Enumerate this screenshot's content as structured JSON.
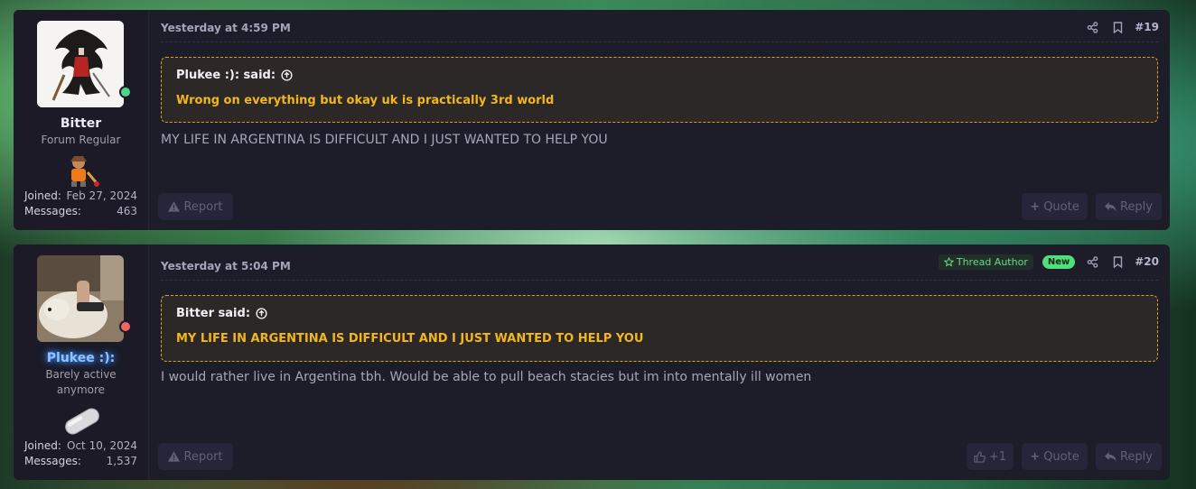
{
  "posts": [
    {
      "user": {
        "name": "Bitter",
        "title": "Forum Regular",
        "joined_label": "Joined:",
        "joined_value": "Feb 27, 2024",
        "messages_label": "Messages:",
        "messages_value": "463",
        "status": "online"
      },
      "date": "Yesterday at 4:59 PM",
      "number": "#19",
      "quote": {
        "author": "Plukee :): said:",
        "text": "Wrong on everything but okay uk is practically 3rd world"
      },
      "body": "MY LIFE IN ARGENTINA IS DIFFICULT AND I JUST WANTED TO HELP YOU",
      "actions": {
        "report": "Report",
        "quote": "Quote",
        "reply": "Reply"
      }
    },
    {
      "user": {
        "name": "Plukee :):",
        "title": "Barely active anymore",
        "joined_label": "Joined:",
        "joined_value": "Oct 10, 2024",
        "messages_label": "Messages:",
        "messages_value": "1,537",
        "status": "offline"
      },
      "date": "Yesterday at 5:04 PM",
      "thread_author_badge": "Thread Author",
      "new_badge": "New",
      "number": "#20",
      "quote": {
        "author": "Bitter said:",
        "text": "MY LIFE IN ARGENTINA IS DIFFICULT AND I JUST WANTED TO HELP YOU"
      },
      "body": "I would rather live in Argentina tbh. Would be able to pull beach stacies but im into mentally ill women",
      "actions": {
        "like": "+1",
        "report": "Report",
        "quote": "Quote",
        "reply": "Reply"
      }
    }
  ],
  "colors": {
    "online": "#4fd58a",
    "offline": "#f06464",
    "quote_border": "#d4a514",
    "quote_text": "#f4b719",
    "username_highlight": "#3d8bff"
  },
  "icons": [
    "share-icon",
    "bookmark-icon",
    "arrow-up-circle-icon",
    "warning-icon",
    "plus-icon",
    "reply-icon",
    "thumbs-up-icon",
    "star-icon"
  ]
}
